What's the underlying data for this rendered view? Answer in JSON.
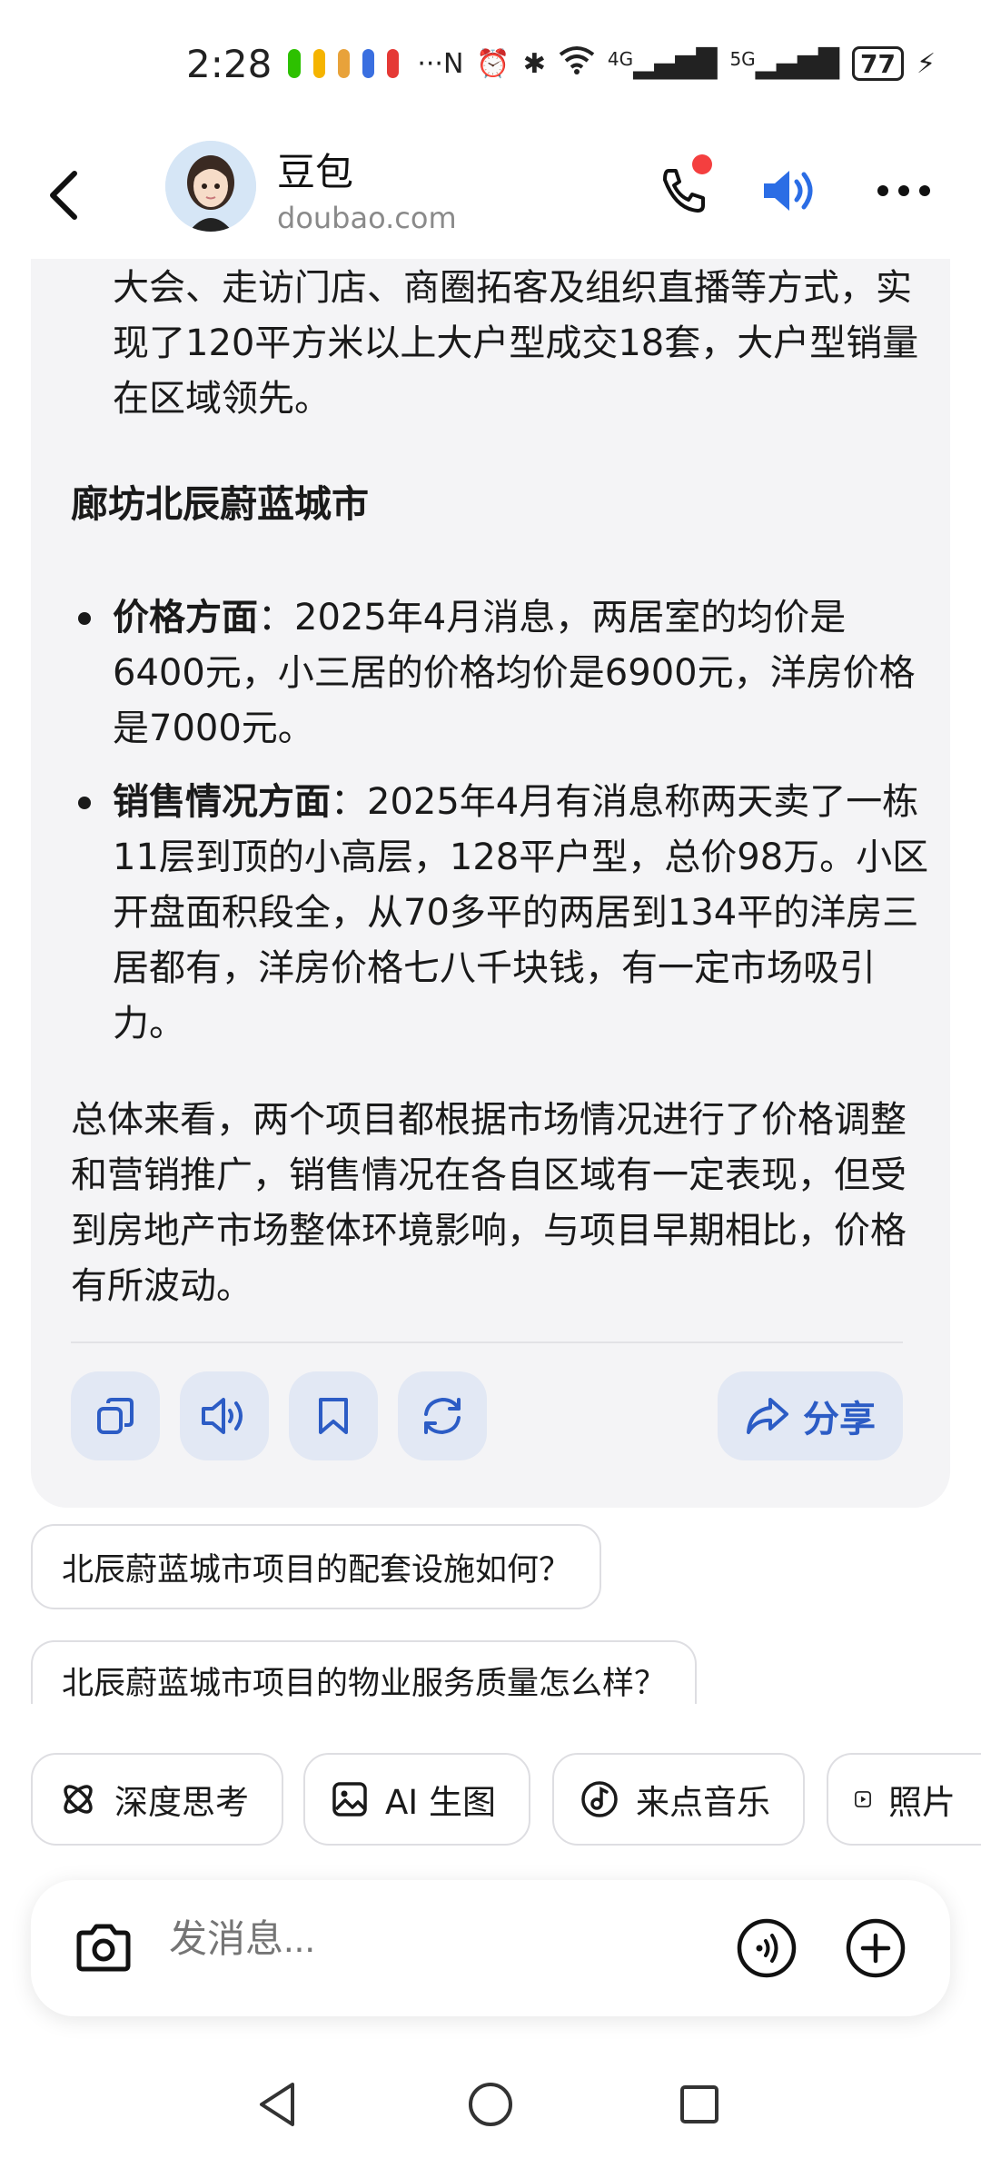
{
  "status_bar": {
    "time": "2:28",
    "more": "···",
    "network_4g": "4G",
    "network_5g": "5G",
    "battery": "77"
  },
  "header": {
    "bot_name": "豆包",
    "bot_domain": "doubao.com",
    "accent_color": "#2b6de5",
    "notification_dot_color": "#f43f3f"
  },
  "message": {
    "continuation": "大会、走访门店、商圈拓客及组织直播等方式，实现了120平方米以上大户型成交18套，大户型销量在区域领先。",
    "section_title": "廊坊北辰蔚蓝城市",
    "bullets": [
      {
        "label": "价格方面",
        "text": "：2025年4月消息，两居室的均价是6400元，小三居的价格均价是6900元，洋房价格是7000元。"
      },
      {
        "label": "销售情况方面",
        "text": "：2025年4月有消息称两天卖了一栋11层到顶的小高层，128平户型，总价98万。小区开盘面积段全，从70多平的两居到134平的洋房三居都有，洋房价格七八千块钱，有一定市场吸引力。"
      }
    ],
    "summary": "总体来看，两个项目都根据市场情况进行了价格调整和营销推广，销售情况在各自区域有一定表现，但受到房地产市场整体环境影响，与项目早期相比，价格有所波动。",
    "share_label": "分享"
  },
  "suggestions": [
    "北辰蔚蓝城市项目的配套设施如何？",
    "北辰蔚蓝城市项目的物业服务质量怎么样？"
  ],
  "chips": [
    {
      "label": "深度思考",
      "icon": "atom-icon"
    },
    {
      "label": "AI 生图",
      "icon": "image-icon"
    },
    {
      "label": "来点音乐",
      "icon": "music-icon"
    },
    {
      "label": "照片",
      "icon": "play-icon"
    }
  ],
  "input": {
    "placeholder": "发消息..."
  }
}
